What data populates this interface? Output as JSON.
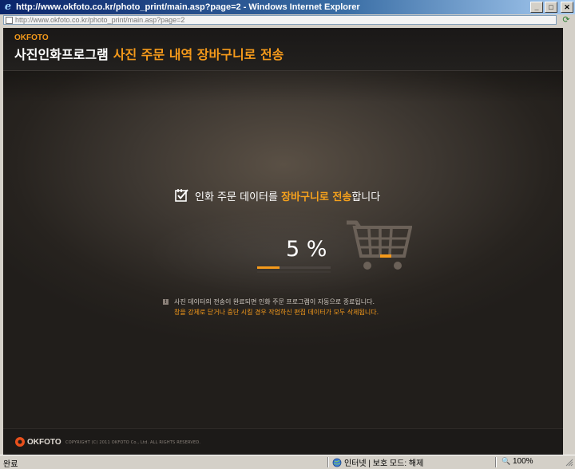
{
  "window": {
    "title": "http://www.okfoto.co.kr/photo_print/main.asp?page=2 - Windows Internet Explorer",
    "address": "http://www.okfoto.co.kr/photo_print/main.asp?page=2"
  },
  "header": {
    "brand": "OKFOTO",
    "title_main": "사진인화프로그램",
    "title_sub": "사진 주문 내역 장바구니로 전송"
  },
  "status": {
    "prefix": "인화 주문 데이터를 ",
    "highlight": "장바구니로 전송",
    "suffix": "합니다"
  },
  "progress": {
    "percent_label": "5 %",
    "value": 0.05
  },
  "notice": {
    "line1": "사진 데이터의 전송이 완료되면 인화 주문 프로그램이 자동으로 종료됩니다.",
    "line2": "창을 강제로 닫거나 중단 시킬 경우 작업하신 편집 데이터가 모두 삭제됩니다."
  },
  "footer": {
    "logo_text": "OKFOTO",
    "copyright": "COPYRIGHT (C) 2011 OKFOTO Co., Ltd. ALL RIGHTS RESERVED."
  },
  "statusbar": {
    "done": "완료",
    "zone": "인터넷 | 보호 모드: 해제",
    "zoom": "100%"
  },
  "colors": {
    "accent": "#f59a1b",
    "background": "#2b2723"
  },
  "icons": [
    "ie-icon",
    "check-icon",
    "cart-icon",
    "globe-icon",
    "zoom-icon",
    "refresh-icon"
  ]
}
